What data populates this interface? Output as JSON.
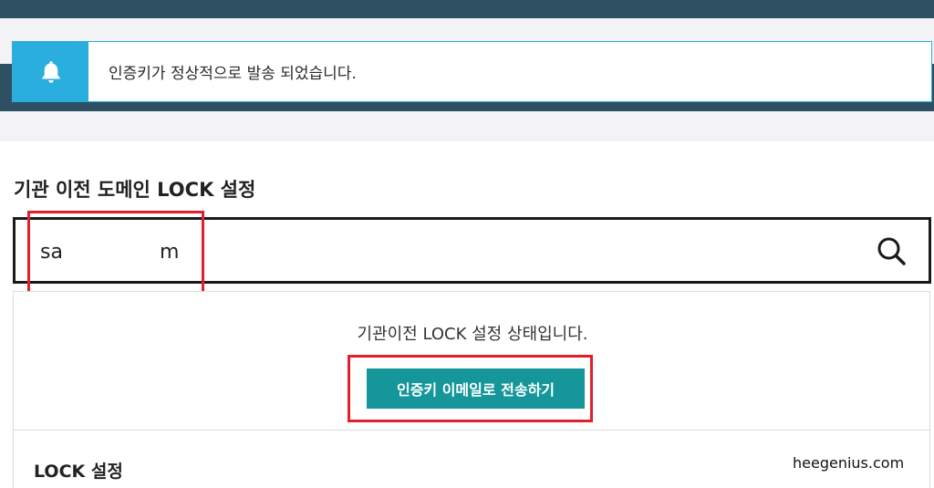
{
  "notice": {
    "icon": "bell-icon",
    "message": "인증키가 정상적으로 발송 되었습니다."
  },
  "section": {
    "title": "기관 이전 도메인 LOCK 설정"
  },
  "search": {
    "value_start": "sa",
    "value_end": "m",
    "icon": "search-icon"
  },
  "status": {
    "message": "기관이전 LOCK 설정 상태입니다.",
    "send_button_label": "인증키 이메일로 전송하기"
  },
  "lock": {
    "title": "LOCK 설정"
  },
  "watermark": "heegenius.com",
  "colors": {
    "header": "#2f4f62",
    "notice_accent": "#29aede",
    "button": "#14969b",
    "highlight": "#e0202a"
  }
}
